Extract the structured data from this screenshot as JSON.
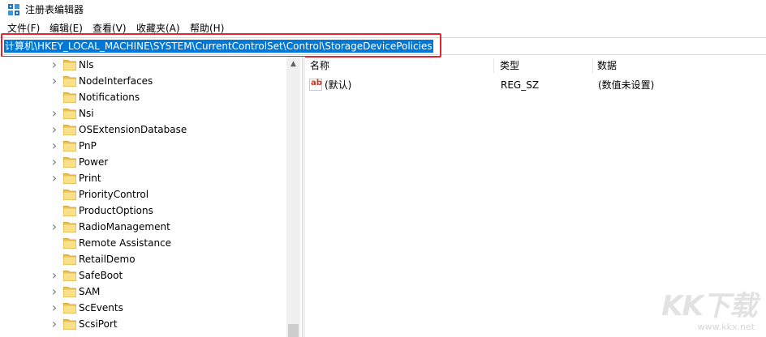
{
  "window": {
    "title": "注册表编辑器",
    "icon": "registry-editor-icon"
  },
  "menu": [
    {
      "label": "文件(F)"
    },
    {
      "label": "编辑(E)"
    },
    {
      "label": "查看(V)"
    },
    {
      "label": "收藏夹(A)"
    },
    {
      "label": "帮助(H)"
    }
  ],
  "address": {
    "path": "计算机\\HKEY_LOCAL_MACHINE\\SYSTEM\\CurrentControlSet\\Control\\StorageDevicePolicies",
    "highlight_color": "#e3262d",
    "selection_color": "#0078d7"
  },
  "tree": {
    "items": [
      {
        "label": "Nls",
        "expandable": true
      },
      {
        "label": "NodeInterfaces",
        "expandable": true
      },
      {
        "label": "Notifications",
        "expandable": false
      },
      {
        "label": "Nsi",
        "expandable": true
      },
      {
        "label": "OSExtensionDatabase",
        "expandable": true
      },
      {
        "label": "PnP",
        "expandable": true
      },
      {
        "label": "Power",
        "expandable": true
      },
      {
        "label": "Print",
        "expandable": true
      },
      {
        "label": "PriorityControl",
        "expandable": false
      },
      {
        "label": "ProductOptions",
        "expandable": false
      },
      {
        "label": "RadioManagement",
        "expandable": true
      },
      {
        "label": "Remote Assistance",
        "expandable": false
      },
      {
        "label": "RetailDemo",
        "expandable": false
      },
      {
        "label": "SafeBoot",
        "expandable": true
      },
      {
        "label": "SAM",
        "expandable": true
      },
      {
        "label": "ScEvents",
        "expandable": true
      },
      {
        "label": "ScsiPort",
        "expandable": true
      }
    ]
  },
  "list": {
    "columns": [
      "名称",
      "类型",
      "数据"
    ],
    "rows": [
      {
        "name": "(默认)",
        "type": "REG_SZ",
        "data": "(数值未设置)",
        "icon": "string-value-icon"
      }
    ]
  },
  "watermark": {
    "brand": "KK下载",
    "url": "www.kkx.net"
  }
}
